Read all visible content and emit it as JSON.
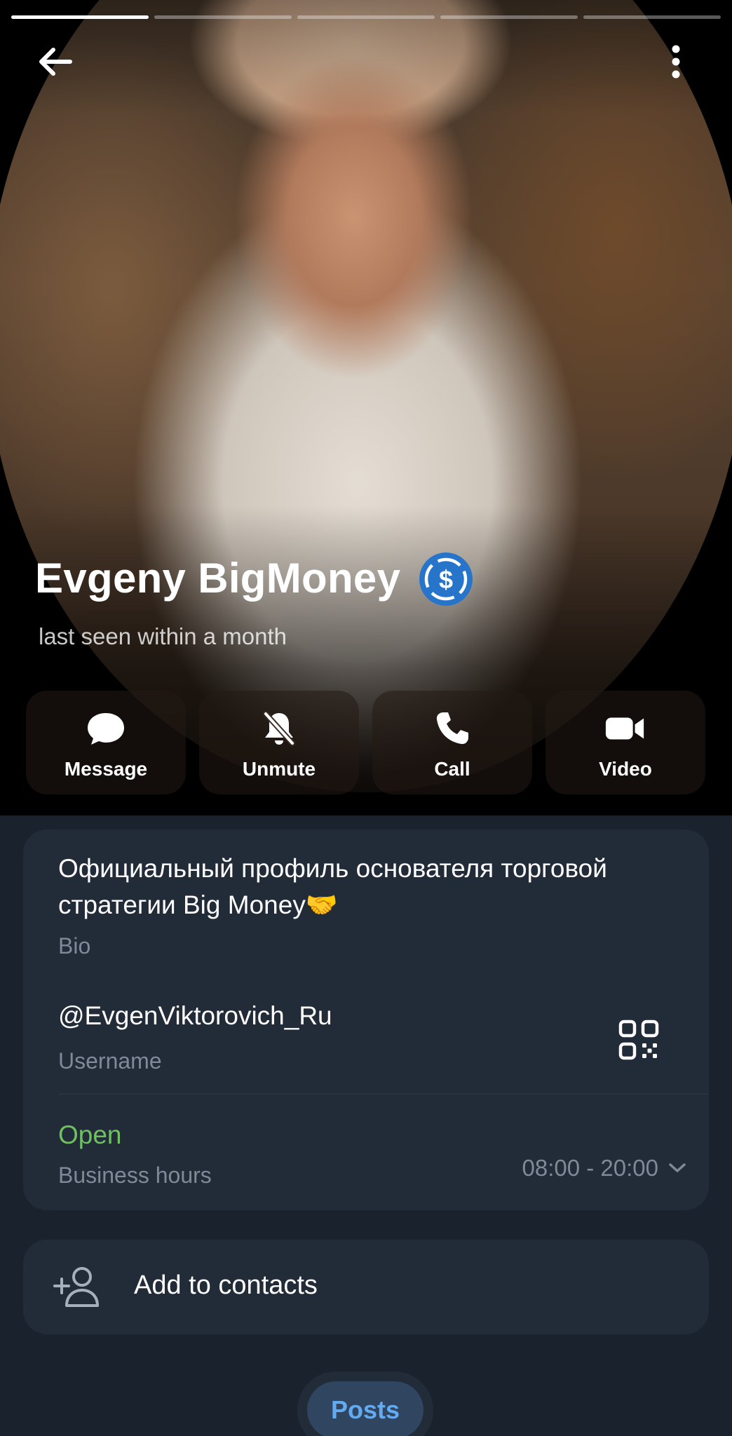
{
  "header": {
    "name": "Evgeny BigMoney",
    "status": "last seen within a month",
    "story_segments": 5,
    "active_segment": 1
  },
  "actions": [
    {
      "label": "Message",
      "icon": "message-bubble-icon"
    },
    {
      "label": "Unmute",
      "icon": "bell-off-icon"
    },
    {
      "label": "Call",
      "icon": "phone-icon"
    },
    {
      "label": "Video",
      "icon": "video-camera-icon"
    }
  ],
  "info": {
    "bio": "Официальный профиль основателя торговой стратегии Big Money",
    "bio_emoji": "🤝",
    "bio_label": "Bio",
    "username": "@EvgenViktorovich_Ru",
    "username_label": "Username",
    "business_status": "Open",
    "business_label": "Business hours",
    "hours": "08:00 - 20:00"
  },
  "add_contact": {
    "label": "Add to contacts"
  },
  "tabs": [
    {
      "label": "Posts",
      "active": true
    }
  ],
  "colors": {
    "background": "#1a222d",
    "card": "#222b38",
    "accent": "#63aaf0",
    "open_green": "#6fc060",
    "secondary_text": "#7f8a98",
    "badge_blue": "#2775ca"
  }
}
